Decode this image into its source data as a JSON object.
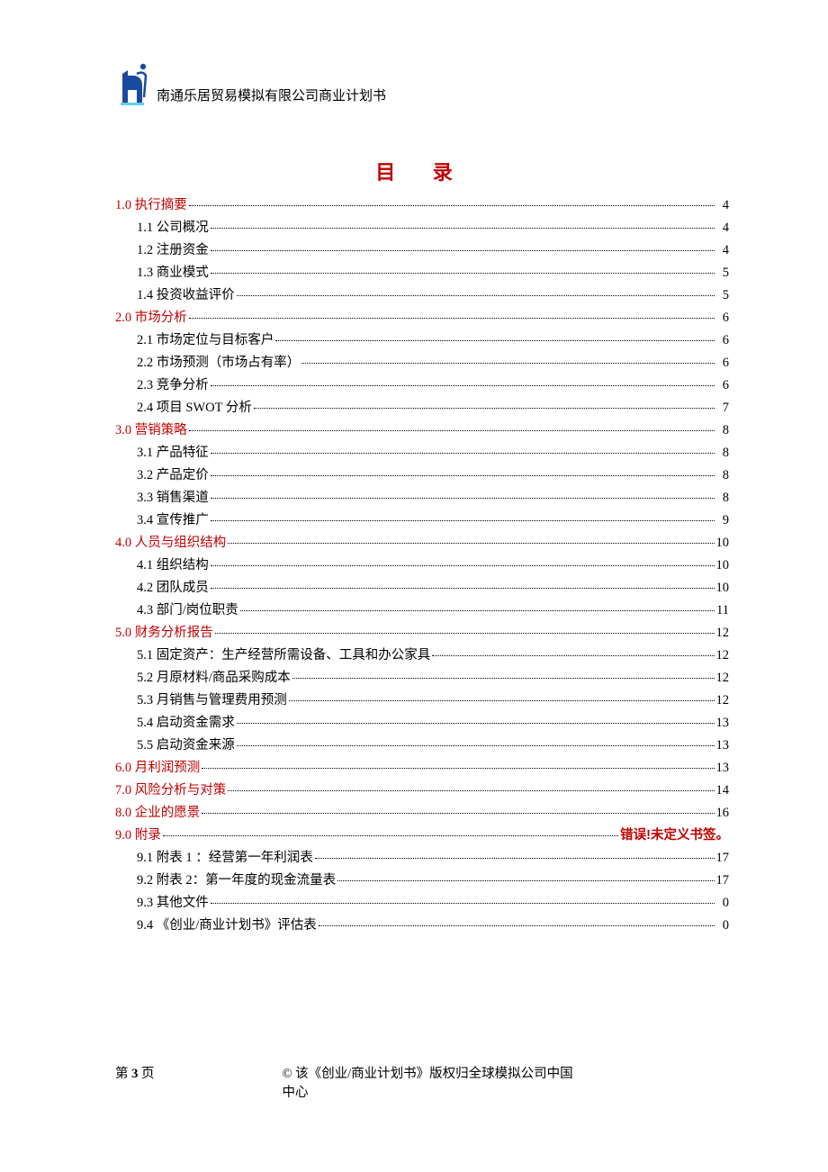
{
  "header": {
    "title": "南通乐居贸易模拟有限公司商业计划书"
  },
  "toc_title": "目 录",
  "toc": [
    {
      "level": 1,
      "label": "1.0 执行摘要",
      "page": "4"
    },
    {
      "level": 2,
      "label": "1.1 公司概况",
      "page": "4"
    },
    {
      "level": 2,
      "label": "1.2 注册资金",
      "page": "4"
    },
    {
      "level": 2,
      "label": "1.3 商业模式",
      "page": "5"
    },
    {
      "level": 2,
      "label": "1.4 投资收益评价",
      "page": "5"
    },
    {
      "level": 1,
      "label": "2.0 市场分析",
      "page": "6"
    },
    {
      "level": 2,
      "label": "2.1 市场定位与目标客户",
      "page": "6"
    },
    {
      "level": 2,
      "label": "2.2 市场预测（市场占有率）",
      "page": "6"
    },
    {
      "level": 2,
      "label": "2.3 竞争分析",
      "page": "6"
    },
    {
      "level": 2,
      "label": "2.4 项目 SWOT 分析",
      "page": "7"
    },
    {
      "level": 1,
      "label": "3.0  营销策略",
      "page": "8"
    },
    {
      "level": 2,
      "label": "3.1 产品特征",
      "page": "8"
    },
    {
      "level": 2,
      "label": "3.2 产品定价",
      "page": "8"
    },
    {
      "level": 2,
      "label": "3.3  销售渠道",
      "page": "8"
    },
    {
      "level": 2,
      "label": "3.4 宣传推广",
      "page": "9"
    },
    {
      "level": 1,
      "label": "4.0  人员与组织结构",
      "page": "10"
    },
    {
      "level": 2,
      "label": "4.1 组织结构",
      "page": "10"
    },
    {
      "level": 2,
      "label": "4.2 团队成员",
      "page": "10"
    },
    {
      "level": 2,
      "label": "4.3 部门/岗位职责",
      "page": "11"
    },
    {
      "level": 1,
      "label": "5.0 财务分析报告",
      "page": "12"
    },
    {
      "level": 2,
      "label": "5.1 固定资产：生产经营所需设备、工具和办公家具",
      "page": "12"
    },
    {
      "level": 2,
      "label": "5.2 月原材料/商品采购成本",
      "page": "12"
    },
    {
      "level": 2,
      "label": "5.3 月销售与管理费用预测",
      "page": "12"
    },
    {
      "level": 2,
      "label": "5.4 启动资金需求",
      "page": "13"
    },
    {
      "level": 2,
      "label": "5.5 启动资金来源",
      "page": "13"
    },
    {
      "level": 1,
      "label": "6.0 月利润预测",
      "page": "13"
    },
    {
      "level": 1,
      "label": "7.0 风险分析与对策",
      "page": "14"
    },
    {
      "level": 1,
      "label": "8.0 企业的愿景",
      "page": "16"
    },
    {
      "level": 1,
      "label": "9.0 附录",
      "page": "错误!未定义书签。",
      "error": true
    },
    {
      "level": 2,
      "label": "9.1 附表 1 ：经营第一年利润表",
      "page": "17"
    },
    {
      "level": 2,
      "label": "9.2  附表 2：第一年度的现金流量表",
      "page": "17"
    },
    {
      "level": 2,
      "label": "9.3 其他文件",
      "page": "0"
    },
    {
      "level": 2,
      "label": "9.4 《创业/商业计划书》评估表",
      "page": "0"
    }
  ],
  "footer": {
    "left_prefix": "第 ",
    "page_number": "3",
    "left_suffix": " 页",
    "center": "© 该《创业/商业计划书》版权归全球模拟公司中国中心"
  }
}
